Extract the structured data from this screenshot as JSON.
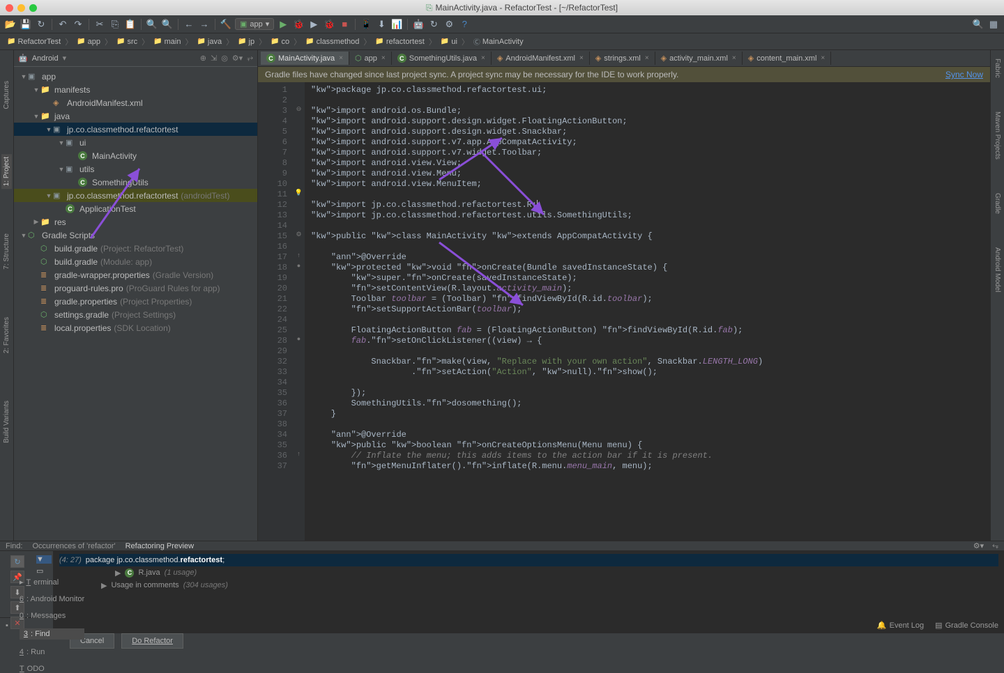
{
  "title": "MainActivity.java - RefactorTest - [~/RefactorTest]",
  "runConfig": "app",
  "breadcrumb": [
    "RefactorTest",
    "app",
    "src",
    "main",
    "java",
    "jp",
    "co",
    "classmethod",
    "refactortest",
    "ui",
    "MainActivity"
  ],
  "projectView": "Android",
  "tree": [
    {
      "d": 0,
      "arr": "▼",
      "ic": "mod",
      "t": "app"
    },
    {
      "d": 1,
      "arr": "▼",
      "ic": "fld",
      "t": "manifests"
    },
    {
      "d": 2,
      "arr": "",
      "ic": "xml",
      "t": "AndroidManifest.xml"
    },
    {
      "d": 1,
      "arr": "▼",
      "ic": "fld",
      "t": "java"
    },
    {
      "d": 2,
      "arr": "▼",
      "ic": "pkg",
      "t": "jp.co.classmethod.refactortest",
      "sel": true
    },
    {
      "d": 3,
      "arr": "▼",
      "ic": "pkg",
      "t": "ui"
    },
    {
      "d": 4,
      "arr": "",
      "ic": "cls",
      "t": "MainActivity"
    },
    {
      "d": 3,
      "arr": "▼",
      "ic": "pkg",
      "t": "utils"
    },
    {
      "d": 4,
      "arr": "",
      "ic": "cls",
      "t": "SomethingUtils"
    },
    {
      "d": 2,
      "arr": "▼",
      "ic": "pkg",
      "t": "jp.co.classmethod.refactortest",
      "hint": "(androidTest)",
      "hl": true
    },
    {
      "d": 3,
      "arr": "",
      "ic": "cls",
      "t": "ApplicationTest"
    },
    {
      "d": 1,
      "arr": "▶",
      "ic": "fld",
      "t": "res"
    },
    {
      "d": 0,
      "arr": "▼",
      "ic": "grd",
      "t": "Gradle Scripts"
    },
    {
      "d": 1,
      "arr": "",
      "ic": "grd",
      "t": "build.gradle",
      "hint": "(Project: RefactorTest)"
    },
    {
      "d": 1,
      "arr": "",
      "ic": "grd",
      "t": "build.gradle",
      "hint": "(Module: app)"
    },
    {
      "d": 1,
      "arr": "",
      "ic": "prop",
      "t": "gradle-wrapper.properties",
      "hint": "(Gradle Version)"
    },
    {
      "d": 1,
      "arr": "",
      "ic": "prop",
      "t": "proguard-rules.pro",
      "hint": "(ProGuard Rules for app)"
    },
    {
      "d": 1,
      "arr": "",
      "ic": "prop",
      "t": "gradle.properties",
      "hint": "(Project Properties)"
    },
    {
      "d": 1,
      "arr": "",
      "ic": "grd",
      "t": "settings.gradle",
      "hint": "(Project Settings)"
    },
    {
      "d": 1,
      "arr": "",
      "ic": "prop",
      "t": "local.properties",
      "hint": "(SDK Location)"
    }
  ],
  "tabs": [
    {
      "ic": "cls",
      "t": "MainActivity.java",
      "active": true
    },
    {
      "ic": "grd",
      "t": "app"
    },
    {
      "ic": "cls",
      "t": "SomethingUtils.java"
    },
    {
      "ic": "xml",
      "t": "AndroidManifest.xml"
    },
    {
      "ic": "xml",
      "t": "strings.xml"
    },
    {
      "ic": "xml",
      "t": "activity_main.xml"
    },
    {
      "ic": "xml",
      "t": "content_main.xml"
    }
  ],
  "syncMsg": "Gradle files have changed since last project sync. A project sync may be necessary for the IDE to work properly.",
  "syncLink": "Sync Now",
  "code": [
    "package jp.co.classmethod.refactortest.ui;",
    "",
    "import android.os.Bundle;",
    "import android.support.design.widget.FloatingActionButton;",
    "import android.support.design.widget.Snackbar;",
    "import android.support.v7.app.AppCompatActivity;",
    "import android.support.v7.widget.Toolbar;",
    "import android.view.View;",
    "import android.view.Menu;",
    "import android.view.MenuItem;",
    "",
    "import jp.co.classmethod.refactortest.R;",
    "import jp.co.classmethod.refactortest.utils.SomethingUtils;",
    "",
    "public class MainActivity extends AppCompatActivity {",
    "",
    "    @Override",
    "    protected void onCreate(Bundle savedInstanceState) {",
    "        super.onCreate(savedInstanceState);",
    "        setContentView(R.layout.activity_main);",
    "        Toolbar toolbar = (Toolbar) findViewById(R.id.toolbar);",
    "        setSupportActionBar(toolbar);",
    "",
    "        FloatingActionButton fab = (FloatingActionButton) findViewById(R.id.fab);",
    "        fab.setOnClickListener((view) → {",
    "",
    "            Snackbar.make(view, \"Replace with your own action\", Snackbar.LENGTH_LONG)",
    "                    .setAction(\"Action\", null).show();",
    "",
    "        });",
    "        SomethingUtils.dosomething();",
    "    }",
    "",
    "    @Override",
    "    public boolean onCreateOptionsMenu(Menu menu) {",
    "        // Inflate the menu; this adds items to the action bar if it is present.",
    "        getMenuInflater().inflate(R.menu.menu_main, menu);"
  ],
  "lineNumbers": [
    "1",
    "2",
    "3",
    "4",
    "5",
    "6",
    "7",
    "8",
    "9",
    "10",
    "11",
    "12",
    "13",
    "14",
    "15",
    "16",
    "17",
    "18",
    "19",
    "20",
    "21",
    "22",
    "24",
    "25",
    "28",
    "29",
    "32",
    "33",
    "34",
    "35",
    "36",
    "37",
    "38"
  ],
  "findTabs": [
    "Find:",
    "Occurrences of 'refactor'",
    "Refactoring Preview"
  ],
  "findLoc": "(4: 27)",
  "findTitle": "package jp.co.classmethod.refactortest;",
  "findR1": "R.java",
  "findR1h": "(1 usage)",
  "findR2": "Usage in comments",
  "findR2h": "(304 usages)",
  "btnCancel": "Cancel",
  "btnRefactor": "Do Refactor",
  "statusTabs": [
    "Terminal",
    "6: Android Monitor",
    "0: Messages",
    "3: Find",
    "4: Run",
    "TODO"
  ],
  "statusRight": [
    "Event Log",
    "Gradle Console"
  ],
  "leftVTabs": [
    "Captures",
    "1: Project",
    "7: Structure",
    "2: Favorites",
    "Build Variants"
  ],
  "rightVTabs": [
    "Fabric",
    "Maven Projects",
    "Gradle",
    "Android Model"
  ]
}
